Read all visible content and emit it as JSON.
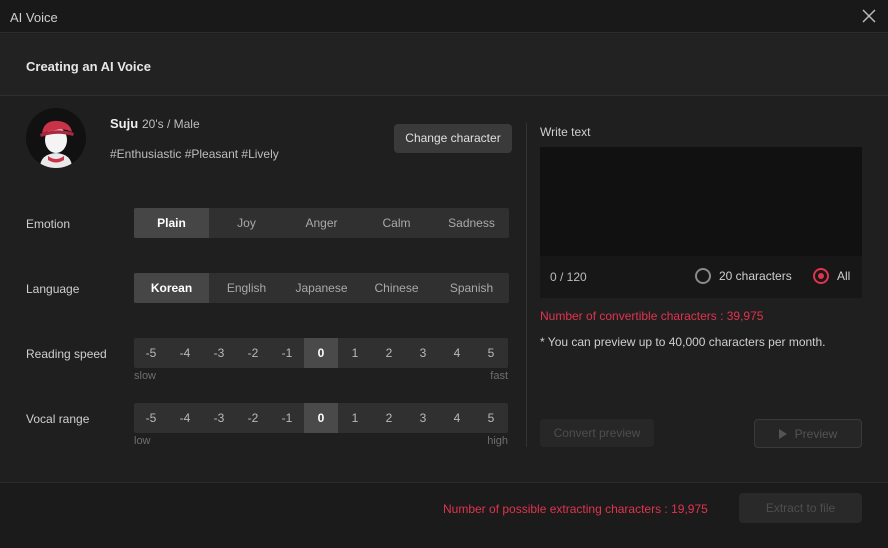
{
  "window": {
    "title": "AI Voice"
  },
  "header": {
    "heading": "Creating an AI Voice"
  },
  "character": {
    "name": "Suju",
    "meta": "20's / Male",
    "tags": "#Enthusiastic #Pleasant #Lively",
    "change_label": "Change character"
  },
  "emotion": {
    "label": "Emotion",
    "options": [
      "Plain",
      "Joy",
      "Anger",
      "Calm",
      "Sadness"
    ],
    "selected": "Plain"
  },
  "language": {
    "label": "Language",
    "options": [
      "Korean",
      "English",
      "Japanese",
      "Chinese",
      "Spanish"
    ],
    "selected": "Korean"
  },
  "reading_speed": {
    "label": "Reading speed",
    "steps": [
      "-5",
      "-4",
      "-3",
      "-2",
      "-1",
      "0",
      "1",
      "2",
      "3",
      "4",
      "5"
    ],
    "selected": "0",
    "min_label": "slow",
    "max_label": "fast"
  },
  "vocal_range": {
    "label": "Vocal range",
    "steps": [
      "-5",
      "-4",
      "-3",
      "-2",
      "-1",
      "0",
      "1",
      "2",
      "3",
      "4",
      "5"
    ],
    "selected": "0",
    "min_label": "low",
    "max_label": "high"
  },
  "text_panel": {
    "label": "Write text",
    "value": "",
    "count": "0 / 120",
    "radio_20": "20 characters",
    "radio_all": "All",
    "radio_selected": "All",
    "convertible": "Number of convertible characters : 39,975",
    "note": "* You can preview up to 40,000 characters per month.",
    "convert_label": "Convert preview",
    "preview_label": "Preview"
  },
  "footer": {
    "extracting": "Number of possible extracting characters : 19,975",
    "extract_label": "Extract to file"
  },
  "colors": {
    "accent": "#e0344e",
    "avatar_hat": "#c9334a",
    "background": "#1f1f1f"
  }
}
